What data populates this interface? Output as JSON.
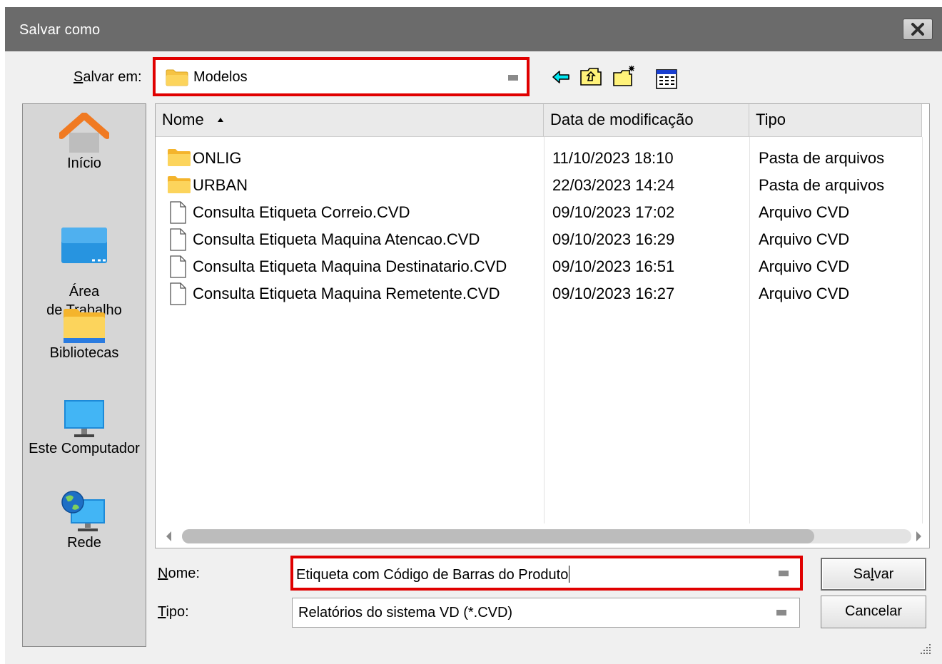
{
  "window": {
    "title": "Salvar como"
  },
  "save_in": {
    "label_prefix": "S",
    "label_rest": "alvar em:",
    "value": "Modelos"
  },
  "toolbar": {
    "icons": [
      "back-arrow-icon",
      "up-folder-icon",
      "new-folder-icon",
      "view-menu-icon"
    ]
  },
  "places": [
    {
      "label": "Início",
      "icon": "home-icon"
    },
    {
      "label": "Área\nde Trabalho",
      "icon": "desktop-icon"
    },
    {
      "label": "Bibliotecas",
      "icon": "libraries-folder-icon"
    },
    {
      "label": "Este Computador",
      "icon": "computer-icon"
    },
    {
      "label": "Rede",
      "icon": "network-icon"
    }
  ],
  "columns": {
    "name": "Nome",
    "date": "Data de modificação",
    "type": "Tipo"
  },
  "files": [
    {
      "name": "ONLIG",
      "date": "11/10/2023 18:10",
      "type": "Pasta de arquivos",
      "kind": "folder"
    },
    {
      "name": "URBAN",
      "date": "22/03/2023 14:24",
      "type": "Pasta de arquivos",
      "kind": "folder"
    },
    {
      "name": "Consulta Etiqueta Correio.CVD",
      "date": "09/10/2023 17:02",
      "type": "Arquivo CVD",
      "kind": "file"
    },
    {
      "name": "Consulta Etiqueta Maquina Atencao.CVD",
      "date": "09/10/2023 16:29",
      "type": "Arquivo CVD",
      "kind": "file"
    },
    {
      "name": "Consulta Etiqueta Maquina Destinatario.CVD",
      "date": "09/10/2023 16:51",
      "type": "Arquivo CVD",
      "kind": "file"
    },
    {
      "name": "Consulta Etiqueta Maquina Remetente.CVD",
      "date": "09/10/2023 16:27",
      "type": "Arquivo CVD",
      "kind": "file"
    }
  ],
  "filename": {
    "label_prefix": "N",
    "label_rest": "ome:",
    "value": "Etiqueta com Código de Barras do Produto"
  },
  "filetype": {
    "label_prefix": "T",
    "label_rest": "ipo:",
    "value": "Relatórios do sistema VD (*.CVD)"
  },
  "buttons": {
    "save_a": "Sa",
    "save_u": "l",
    "save_b": "var",
    "cancel": "Cancelar"
  },
  "colors": {
    "highlight": "#e00000",
    "titlebar": "#6b6b6b",
    "folder": "#f6c343"
  }
}
